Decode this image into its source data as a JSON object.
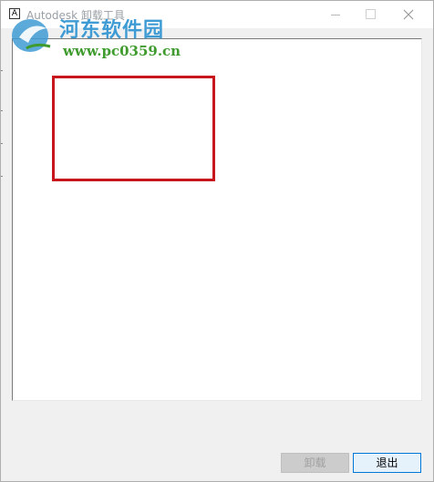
{
  "window": {
    "title": "Autodesk 卸载工具",
    "icon": "autodesk-app-icon",
    "icon_glyph": "A",
    "controls": [
      "minimize-icon",
      "maximize-icon",
      "close-icon"
    ]
  },
  "watermark": {
    "site_name": "河东软件园",
    "url": "www.pc0359.cn",
    "colors": {
      "name": "#3e9bd4",
      "url": "#3f9b2e"
    }
  },
  "highlight": {
    "color": "#c8161d"
  },
  "buttons": {
    "uninstall_label": "卸载",
    "uninstall_enabled": false,
    "exit_label": "退出"
  }
}
